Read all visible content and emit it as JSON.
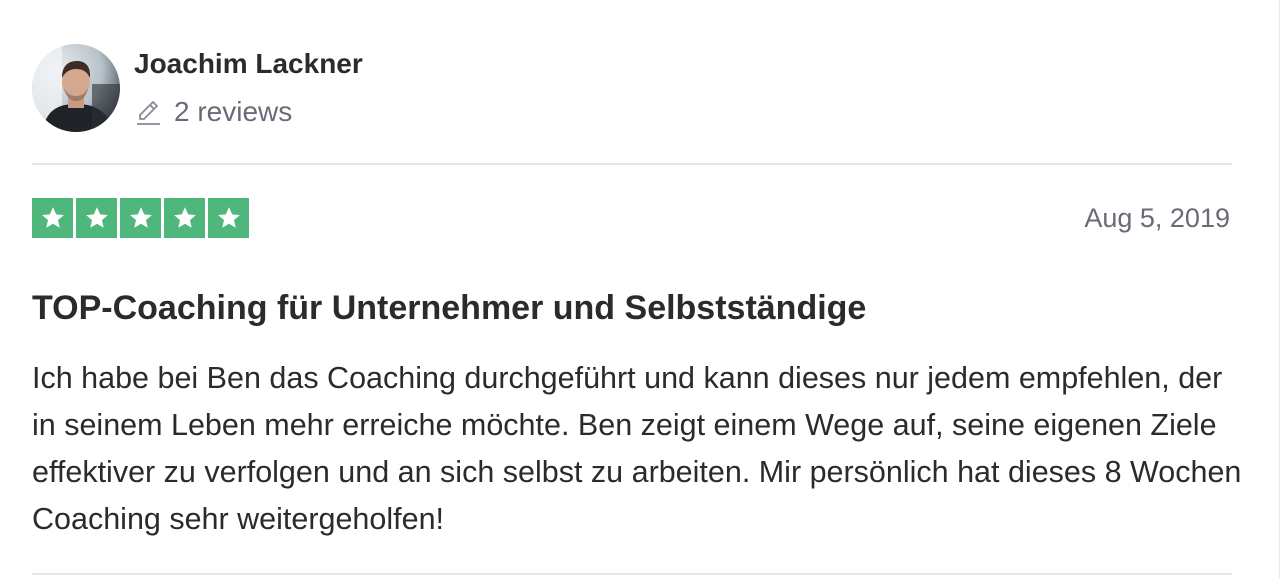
{
  "reviewer": {
    "name": "Joachim Lackner",
    "reviews_count": "2 reviews",
    "avatar_icon": "avatar-photo"
  },
  "review": {
    "rating": 5,
    "max_rating": 5,
    "date": "Aug 5, 2019",
    "title": "TOP-Coaching für Unternehmer und Selbstständige",
    "body": "Ich habe bei Ben das Coaching durchgeführt und kann dieses nur jedem empfehlen, der in seinem Leben mehr erreiche möchte. Ben zeigt einem Wege auf, seine eigenen Ziele effektiver zu verfolgen und an sich selbst zu arbeiten. Mir persönlich hat dieses 8 Wochen Coaching sehr weitergeholfen!"
  },
  "colors": {
    "star_green": "#4fb77c",
    "text_dark": "#2b2b2b",
    "text_muted": "#6b6b78",
    "divider": "#e6e6e6"
  }
}
